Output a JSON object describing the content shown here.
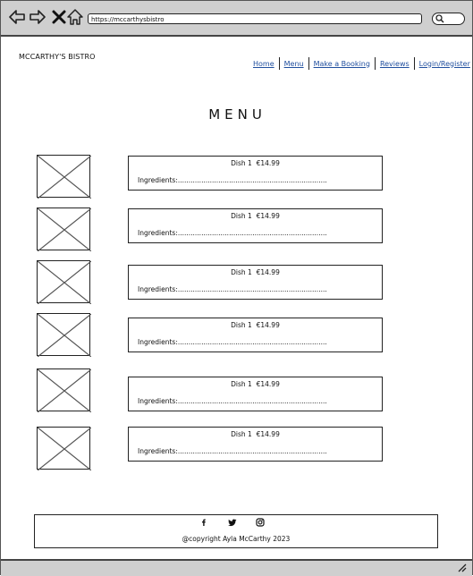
{
  "browser": {
    "url": "https://mccarthysbistro"
  },
  "header": {
    "brand": "MCCARTHY'S BISTRO",
    "nav": [
      {
        "label": "Home"
      },
      {
        "label": "Menu"
      },
      {
        "label": "Make a Booking"
      },
      {
        "label": "Reviews"
      },
      {
        "label": "Login/Register"
      }
    ]
  },
  "main": {
    "title": "MENU",
    "dishes": [
      {
        "name": "Dish 1",
        "price": "€14.99",
        "ingredients": "Ingredients:......................................................................"
      },
      {
        "name": "Dish 1",
        "price": "€14.99",
        "ingredients": "Ingredients:......................................................................"
      },
      {
        "name": "Dish 1",
        "price": "€14.99",
        "ingredients": "Ingredients:......................................................................"
      },
      {
        "name": "Dish 1",
        "price": "€14.99",
        "ingredients": "Ingredients:......................................................................"
      },
      {
        "name": "Dish 1",
        "price": "€14.99",
        "ingredients": "Ingredients:......................................................................"
      },
      {
        "name": "Dish 1",
        "price": "€14.99",
        "ingredients": "Ingredients:......................................................................"
      }
    ]
  },
  "footer": {
    "social": [
      "facebook-icon",
      "twitter-icon",
      "instagram-icon"
    ],
    "copyright": "@copyright Ayla McCarthy 2023"
  }
}
